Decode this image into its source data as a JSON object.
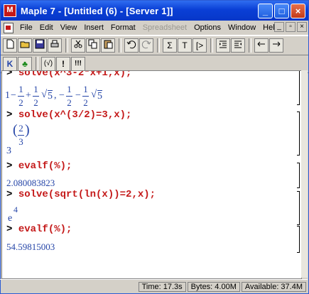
{
  "window": {
    "title": "Maple 7 - [Untitled (6) - [Server 1]]",
    "app_icon_glyph": "M",
    "minimize_glyph": "_",
    "maximize_glyph": "□",
    "close_glyph": "×"
  },
  "menu": {
    "items": [
      "File",
      "Edit",
      "View",
      "Insert",
      "Format",
      "Spreadsheet",
      "Options",
      "Window",
      "Help"
    ],
    "disabled_index": 5,
    "mini_controls": [
      "_",
      "▫",
      "×"
    ]
  },
  "toolbar": {
    "icons": [
      "new-icon",
      "open-icon",
      "save-icon",
      "print-icon",
      "cut-icon",
      "copy-icon",
      "paste-icon",
      "undo-icon",
      "redo-icon",
      "sigma-icon",
      "text-icon",
      "prompt-icon",
      "indent-icon",
      "outdent-icon",
      "back-icon",
      "forward-icon"
    ],
    "glyphs": {
      "sigma": "Σ",
      "text": "T",
      "prompt": "[>"
    }
  },
  "toolbar2": {
    "glyphs": [
      "K",
      "♣",
      "(√)",
      "!",
      "!!!"
    ]
  },
  "worksheet": {
    "prompt": ">",
    "inputs": [
      "solve(x^3-2*x+1,x);",
      "solve(x^(3/2)=3,x);",
      "evalf(%);",
      "solve(sqrt(ln(x))=2,x);",
      "evalf(%);"
    ],
    "output1": {
      "first": "1",
      "minus_half": "−",
      "frac_num": "1",
      "frac_den": "2",
      "plus": "+",
      "sqrt_glyph": "√",
      "radicand": "5",
      "comma": ",",
      "minus": "−"
    },
    "output2": {
      "base": "3",
      "exp_num": "2",
      "exp_den": "3"
    },
    "output3": "2.080083823",
    "output4": {
      "base": "e",
      "exp": "4"
    },
    "output5": "54.59815003"
  },
  "status": {
    "time": "Time: 17.3s",
    "bytes": "Bytes: 4.00M",
    "available": "Available: 37.4M"
  }
}
